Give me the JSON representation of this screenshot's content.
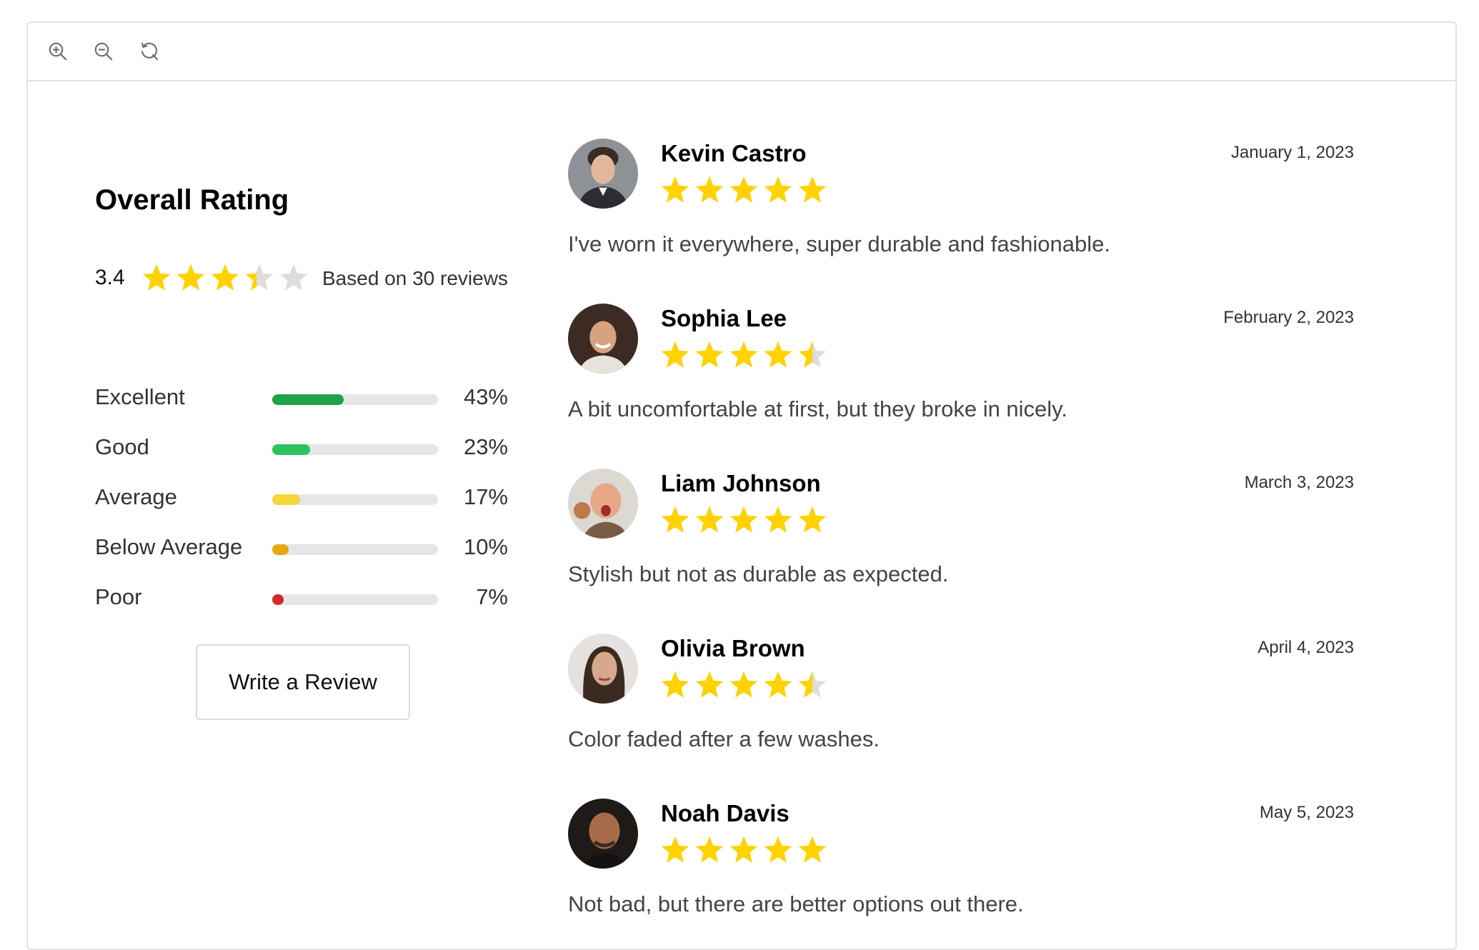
{
  "toolbar": {
    "zoom_in_icon": "zoom-in-icon",
    "zoom_out_icon": "zoom-out-icon",
    "reset_icon": "refresh-icon"
  },
  "summary": {
    "title": "Overall Rating",
    "average": "3.4",
    "average_value": 3.4,
    "based_on": "Based on 30 reviews",
    "distribution": [
      {
        "label": "Excellent",
        "percent": "43%",
        "value": 43,
        "color": "#1fa24a"
      },
      {
        "label": "Good",
        "percent": "23%",
        "value": 23,
        "color": "#2bc45e"
      },
      {
        "label": "Average",
        "percent": "17%",
        "value": 17,
        "color": "#f8d53a"
      },
      {
        "label": "Below Average",
        "percent": "10%",
        "value": 10,
        "color": "#e7a714"
      },
      {
        "label": "Poor",
        "percent": "7%",
        "value": 7,
        "color": "#d8262a"
      }
    ],
    "write_review": "Write a Review"
  },
  "colors": {
    "star": "#FFD200",
    "star_empty": "#dddddd"
  },
  "reviews": [
    {
      "name": "Kevin Castro",
      "date": "January 1, 2023",
      "rating": 5,
      "text": "I've worn it everywhere, super durable and fashionable.",
      "avatar": "avatar-kevin-castro"
    },
    {
      "name": "Sophia Lee",
      "date": "February 2, 2023",
      "rating": 4.5,
      "text": "A bit uncomfortable at first, but they broke in nicely.",
      "avatar": "avatar-sophia-lee"
    },
    {
      "name": "Liam Johnson",
      "date": "March 3, 2023",
      "rating": 5,
      "text": "Stylish but not as durable as expected.",
      "avatar": "avatar-liam-johnson"
    },
    {
      "name": "Olivia Brown",
      "date": "April 4, 2023",
      "rating": 4.5,
      "text": "Color faded after a few washes.",
      "avatar": "avatar-olivia-brown"
    },
    {
      "name": "Noah Davis",
      "date": "May 5, 2023",
      "rating": 5,
      "text": "Not bad, but there are better options out there.",
      "avatar": "avatar-noah-davis"
    }
  ]
}
